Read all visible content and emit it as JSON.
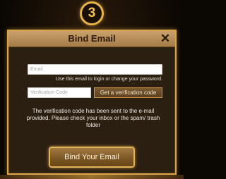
{
  "step": {
    "number": "3"
  },
  "dialog": {
    "title": "Bind Email",
    "close_symbol": "✕",
    "email_field": {
      "placeholder": "Email",
      "value": ""
    },
    "email_hint": "Use this email to login or change your password.",
    "code_field": {
      "placeholder": "Verification Code",
      "value": ""
    },
    "get_code_button_label": "Get a verification code",
    "info_message": "The verification code has been sent to the e-mail provided. Please check your inbox or the spam/ trash folder",
    "bind_button_label": "Bind Your Email"
  },
  "colors": {
    "accent_gold": "#d7a44a",
    "dialog_bg": "#2b1f12",
    "title_bar": "#b88d58",
    "page_bg": "#0b0703"
  },
  "icons": {
    "close": "close-icon",
    "step_badge": "step-number-badge"
  }
}
